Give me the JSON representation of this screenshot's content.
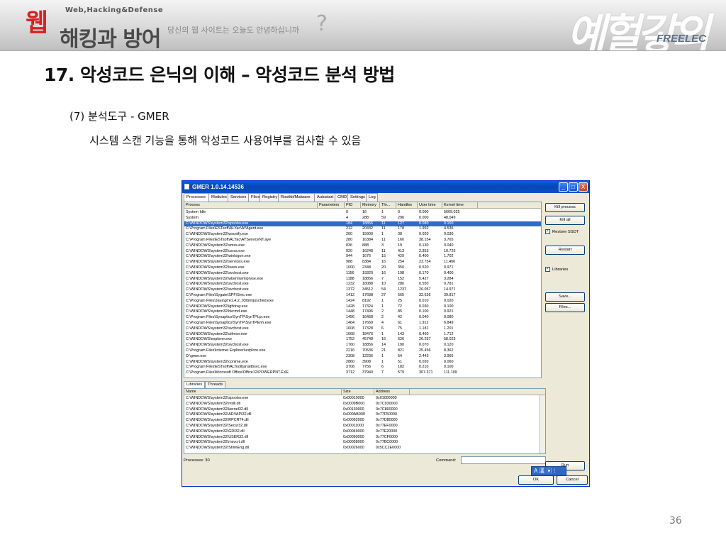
{
  "banner": {
    "logo_char": "웹",
    "logo_brand": "해킹과 방어",
    "logo_sub": "Web,Hacking&Defense",
    "tagline": "당신의 웹 사이트는 오늘도 안녕하십니까",
    "tag_mark": "?",
    "deco_text": "예헐갛의",
    "publisher": "FREELEC"
  },
  "slide": {
    "title": "17. 악성코드 은닉의 이해 – 악성코드 분석 방법",
    "subtitle": "(7) 분석도구 - GMER",
    "description": "시스템 스캔 기능을 통해 악성코드 사용여부를 검사할 수 있음",
    "page_number": "36"
  },
  "gmer": {
    "title": "GMER 1.0.14.14536",
    "window_buttons": {
      "minimize": "_",
      "maximize": "□",
      "close": "X"
    },
    "tabs": [
      "Processes",
      "Modules",
      "Services",
      "Files",
      "Registry",
      "Rootkit/Malware",
      "Autostart",
      "CMD",
      "Settings",
      "Log"
    ],
    "selected_tab": "Processes",
    "process_columns": [
      "Process",
      "Parameters",
      "PID",
      "Memory",
      "Thr...",
      "Handles",
      "User time",
      "Kernel time"
    ],
    "processes": [
      [
        "System Idle",
        "",
        "0",
        "16",
        "1",
        "0",
        "0.000",
        "5609.025"
      ],
      [
        "System",
        "",
        "4",
        "288",
        "59",
        "296",
        "0.000",
        "48.049"
      ],
      [
        "C:\\WINDOWS\\system32\\spoolsv.exe",
        "",
        "184",
        "18856",
        "11",
        "127",
        "0.080",
        "0.160"
      ],
      [
        "C:\\Program Files\\ESTsoft\\ALYac\\AYAgent.exe",
        "",
        "212",
        "20432",
        "11",
        "178",
        "1.992",
        "4.536"
      ],
      [
        "C:\\WINDOWS\\system32\\wscntfy.exe",
        "",
        "260",
        "15900",
        "1",
        "38",
        "0.020",
        "0.030"
      ],
      [
        "C:\\Program Files\\ESTsoft\\ALYac\\AYServiceNT.aye",
        "",
        "280",
        "16384",
        "11",
        "160",
        "38.154",
        "3.765"
      ],
      [
        "C:\\WINDOWS\\system32\\smss.exe",
        "",
        "836",
        "888",
        "3",
        "19",
        "0.130",
        "0.040"
      ],
      [
        "C:\\WINDOWS\\system32\\csrss.exe",
        "",
        "920",
        "16248",
        "11",
        "413",
        "2.353",
        "10.725"
      ],
      [
        "C:\\WINDOWS\\system32\\winlogon.exe",
        "",
        "944",
        "1676",
        "15",
        "429",
        "0.400",
        "1.702"
      ],
      [
        "C:\\WINDOWS\\system32\\services.exe",
        "",
        "988",
        "8384",
        "16",
        "254",
        "23.754",
        "11.406"
      ],
      [
        "C:\\WINDOWS\\system32\\lsass.exe",
        "",
        "1000",
        "2348",
        "20",
        "350",
        "0.520",
        "0.971"
      ],
      [
        "C:\\WINDOWS\\system32\\svchost.exe",
        "",
        "1156",
        "19320",
        "16",
        "198",
        "0.170",
        "0.400"
      ],
      [
        "C:\\WINDOWS\\system32\\wbem\\wmiprvse.exe",
        "",
        "1188",
        "18856",
        "7",
        "152",
        "5.427",
        "3.284"
      ],
      [
        "C:\\WINDOWS\\system32\\svchost.exe",
        "",
        "1232",
        "18088",
        "10",
        "280",
        "0.550",
        "0.781"
      ],
      [
        "C:\\WINDOWS\\system32\\svchost.exe",
        "",
        "1372",
        "34512",
        "54",
        "1237",
        "26.057",
        "14.971"
      ],
      [
        "C:\\Program Files\\Sygate\\SPF\\Smc.exe",
        "",
        "1412",
        "17688",
        "27",
        "565",
        "32.636",
        "39.817"
      ],
      [
        "C:\\Program Files\\Java\\j2re1.4.2_03\\bin\\jusched.exe",
        "",
        "1424",
        "8192",
        "1",
        "25",
        "0.010",
        "0.020"
      ],
      [
        "C:\\WINDOWS\\system32\\igfxtray.exe",
        "",
        "1428",
        "17324",
        "1",
        "72",
        "0.030",
        "0.100"
      ],
      [
        "C:\\WINDOWS\\system32\\hkcmd.exe",
        "",
        "1448",
        "17496",
        "2",
        "85",
        "0.100",
        "0.921"
      ],
      [
        "C:\\Program Files\\Synaptics\\SynTP\\SynTPLpr.exe",
        "",
        "1456",
        "16468",
        "2",
        "42",
        "0.040",
        "0.080"
      ],
      [
        "C:\\Program Files\\Synaptics\\SynTP\\SynTPEnh.exe",
        "",
        "1464",
        "17660",
        "4",
        "61",
        "1.912",
        "6.849"
      ],
      [
        "C:\\WINDOWS\\system32\\svchost.exe",
        "",
        "1608",
        "17328",
        "6",
        "75",
        "1.181",
        "1.201"
      ],
      [
        "C:\\WINDOWS\\system32\\ctfmon.exe",
        "",
        "1668",
        "18476",
        "1",
        "143",
        "0.460",
        "1.712"
      ],
      [
        "C:\\WINDOWS\\explorer.exe",
        "",
        "1752",
        "45748",
        "16",
        "626",
        "26.257",
        "58.023"
      ],
      [
        "C:\\WINDOWS\\system32\\svchost.exe",
        "",
        "1760",
        "18856",
        "14",
        "190",
        "0.070",
        "0.120"
      ],
      [
        "C:\\Program Files\\Internet Explorer\\iexplore.exe",
        "",
        "2216",
        "70536",
        "21",
        "821",
        "25.456",
        "8.362"
      ],
      [
        "D:\\gmer.exe",
        "",
        "2308",
        "12236",
        "1",
        "54",
        "2.443",
        "3.965"
      ],
      [
        "C:\\WINDOWS\\system32\\conime.exe",
        "",
        "2860",
        "3908",
        "1",
        "51",
        "0.020",
        "0.060"
      ],
      [
        "C:\\Program Files\\ESTsoft\\ALToolbar\\altbsvc.exe",
        "",
        "3708",
        "7756",
        "6",
        "182",
        "0.210",
        "0.100"
      ],
      [
        "C:\\Program Files\\Microsoft Office\\Office12\\POWERPNT.EXE",
        "",
        "3712",
        "37940",
        "7",
        "579",
        "307.371",
        "111.109"
      ]
    ],
    "selected_process_index": 2,
    "bottom_tabs": [
      "Libraries",
      "Threads"
    ],
    "library_columns": [
      "Name",
      "Size",
      "Address"
    ],
    "libraries": [
      [
        "C:\\WINDOWS\\system32\\spoolsv.exe",
        "0x00010000",
        "0x01000000"
      ],
      [
        "C:\\WINDOWS\\system32\\ntdll.dll",
        "0x0009B000",
        "0x7C930000"
      ],
      [
        "C:\\WINDOWS\\system32\\kernel32.dll",
        "0x00130000",
        "0x7C800000"
      ],
      [
        "C:\\WINDOWS\\system32\\ADVAPI32.dll",
        "0x000AB000",
        "0x77F50000"
      ],
      [
        "C:\\WINDOWS\\system32\\RPCRT4.dll",
        "0x00092000",
        "0x77D80000"
      ],
      [
        "C:\\WINDOWS\\system32\\Secur32.dll",
        "0x00011000",
        "0x77EF0000"
      ],
      [
        "C:\\WINDOWS\\system32\\GDI32.dll",
        "0x00049000",
        "0x77E20000"
      ],
      [
        "C:\\WINDOWS\\system32\\USER32.dll",
        "0x00090000",
        "0x77CF0000"
      ],
      [
        "C:\\WINDOWS\\system32\\msvcrt.dll",
        "0x00058000",
        "0x77BC0000"
      ],
      [
        "C:\\WINDOWS\\system32\\ShimEng.dll",
        "0x00026000",
        "0x5CC2E0000"
      ]
    ],
    "side_buttons": {
      "kill_process": "Kill process",
      "kill_all": "Kill all",
      "restore_ssdt": "Restore SSDT",
      "restart": "Restart",
      "libraries": "Libraries",
      "save": "Save...",
      "files": "Files...",
      "run": "Run"
    },
    "status_text": "Processes: 30",
    "command_label": "Command:",
    "ok_label": "OK",
    "cancel_label": "Cancel",
    "ime_label": "A 漢 ▣ ⁝"
  },
  "colors": {
    "brand_red": "#d52222",
    "xp_blue": "#0a5fd8",
    "selection": "#316ac5"
  }
}
